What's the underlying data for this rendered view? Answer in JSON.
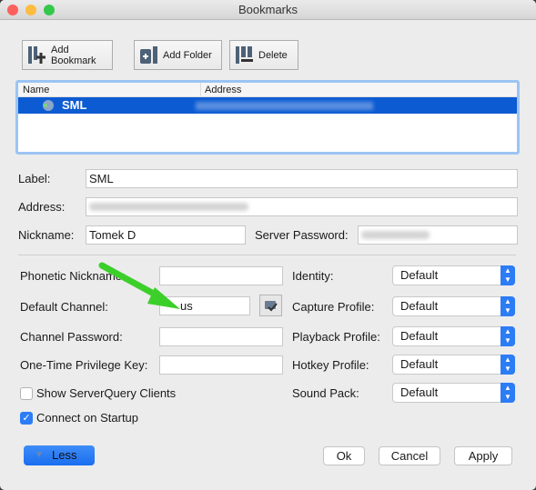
{
  "window": {
    "title": "Bookmarks"
  },
  "toolbar": {
    "add_bookmark": "Add Bookmark",
    "add_folder": "Add Folder",
    "delete": "Delete"
  },
  "list": {
    "columns": [
      "Name",
      "Address"
    ],
    "rows": [
      {
        "name": "SML",
        "address": "",
        "selected": true
      }
    ]
  },
  "form": {
    "label_label": "Label:",
    "label_value": "SML",
    "address_label": "Address:",
    "address_value": "",
    "nickname_label": "Nickname:",
    "nickname_value": "Tomek D",
    "server_password_label": "Server Password:",
    "server_password_value": "",
    "phonetic_label": "Phonetic Nickname:",
    "phonetic_value": "",
    "default_channel_label": "Default Channel:",
    "default_channel_value": "us",
    "channel_password_label": "Channel Password:",
    "channel_password_value": "",
    "privilege_key_label": "One-Time Privilege Key:",
    "privilege_key_value": "",
    "show_serverquery_label": "Show ServerQuery Clients",
    "show_serverquery_checked": false,
    "connect_startup_label": "Connect on Startup",
    "connect_startup_checked": true,
    "identity_label": "Identity:",
    "identity_value": "Default",
    "capture_label": "Capture Profile:",
    "capture_value": "Default",
    "playback_label": "Playback Profile:",
    "playback_value": "Default",
    "hotkey_label": "Hotkey Profile:",
    "hotkey_value": "Default",
    "soundpack_label": "Sound Pack:",
    "soundpack_value": "Default"
  },
  "footer": {
    "less": "Less",
    "ok": "Ok",
    "cancel": "Cancel",
    "apply": "Apply"
  },
  "colors": {
    "accent": "#2c7cf6",
    "selection": "#0c5bd2",
    "annotation_arrow": "#3ccf2a"
  }
}
